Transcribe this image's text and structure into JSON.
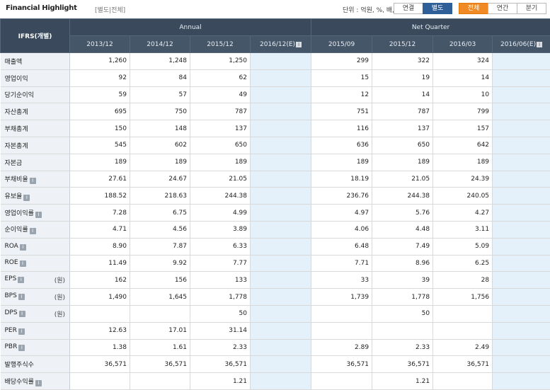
{
  "header": {
    "title": "Financial Highlight",
    "subtitle": "[별도|전체]",
    "unit_label": "단위 : 억원, %, 배, 천주",
    "consolidation_buttons": [
      "연결",
      "별도"
    ],
    "period_buttons": [
      "전체",
      "연간",
      "분기"
    ]
  },
  "table": {
    "corner_label": "IFRS(개별)",
    "group_annual": "Annual",
    "group_quarter": "Net Quarter",
    "columns": [
      "2013/12",
      "2014/12",
      "2015/12",
      "2016/12(E)",
      "2015/09",
      "2015/12",
      "2016/03",
      "2016/06(E)"
    ],
    "rows": [
      {
        "label": "매출액",
        "info": "",
        "unit": "",
        "values": [
          "1,260",
          "1,248",
          "1,250",
          "",
          "299",
          "322",
          "324",
          ""
        ]
      },
      {
        "label": "영업이익",
        "info": "",
        "unit": "",
        "values": [
          "92",
          "84",
          "62",
          "",
          "15",
          "19",
          "14",
          ""
        ]
      },
      {
        "label": "당기순이익",
        "info": "",
        "unit": "",
        "values": [
          "59",
          "57",
          "49",
          "",
          "12",
          "14",
          "10",
          ""
        ]
      },
      {
        "label": "자산총계",
        "info": "",
        "unit": "",
        "values": [
          "695",
          "750",
          "787",
          "",
          "751",
          "787",
          "799",
          ""
        ]
      },
      {
        "label": "부채총계",
        "info": "",
        "unit": "",
        "values": [
          "150",
          "148",
          "137",
          "",
          "116",
          "137",
          "157",
          ""
        ]
      },
      {
        "label": "자본총계",
        "info": "",
        "unit": "",
        "values": [
          "545",
          "602",
          "650",
          "",
          "636",
          "650",
          "642",
          ""
        ]
      },
      {
        "label": "자본금",
        "info": "",
        "unit": "",
        "values": [
          "189",
          "189",
          "189",
          "",
          "189",
          "189",
          "189",
          ""
        ]
      },
      {
        "label": "부채비율",
        "info": "i",
        "unit": "",
        "values": [
          "27.61",
          "24.67",
          "21.05",
          "",
          "18.19",
          "21.05",
          "24.39",
          ""
        ]
      },
      {
        "label": "유보율",
        "info": "i",
        "unit": "",
        "values": [
          "188.52",
          "218.63",
          "244.38",
          "",
          "236.76",
          "244.38",
          "240.05",
          ""
        ]
      },
      {
        "label": "영업이익률",
        "info": "i",
        "unit": "",
        "values": [
          "7.28",
          "6.75",
          "4.99",
          "",
          "4.97",
          "5.76",
          "4.27",
          ""
        ]
      },
      {
        "label": "순이익률",
        "info": "i",
        "unit": "",
        "values": [
          "4.71",
          "4.56",
          "3.89",
          "",
          "4.06",
          "4.48",
          "3.11",
          ""
        ]
      },
      {
        "label": "ROA",
        "info": "i",
        "unit": "",
        "values": [
          "8.90",
          "7.87",
          "6.33",
          "",
          "6.48",
          "7.49",
          "5.09",
          ""
        ]
      },
      {
        "label": "ROE",
        "info": "i",
        "unit": "",
        "values": [
          "11.49",
          "9.92",
          "7.77",
          "",
          "7.71",
          "8.96",
          "6.25",
          ""
        ]
      },
      {
        "label": "EPS",
        "info": "i",
        "unit": "(원)",
        "values": [
          "162",
          "156",
          "133",
          "",
          "33",
          "39",
          "28",
          ""
        ]
      },
      {
        "label": "BPS",
        "info": "i",
        "unit": "(원)",
        "values": [
          "1,490",
          "1,645",
          "1,778",
          "",
          "1,739",
          "1,778",
          "1,756",
          ""
        ]
      },
      {
        "label": "DPS",
        "info": "i",
        "unit": "(원)",
        "values": [
          "",
          "",
          "50",
          "",
          "",
          "50",
          "",
          ""
        ]
      },
      {
        "label": "PER",
        "info": "i",
        "unit": "",
        "values": [
          "12.63",
          "17.01",
          "31.14",
          "",
          "",
          "",
          "",
          ""
        ]
      },
      {
        "label": "PBR",
        "info": "i",
        "unit": "",
        "values": [
          "1.38",
          "1.61",
          "2.33",
          "",
          "2.89",
          "2.33",
          "2.49",
          ""
        ]
      },
      {
        "label": "발행주식수",
        "info": "",
        "unit": "",
        "values": [
          "36,571",
          "36,571",
          "36,571",
          "",
          "36,571",
          "36,571",
          "36,571",
          ""
        ]
      },
      {
        "label": "배당수익률",
        "info": "i",
        "unit": "",
        "values": [
          "",
          "",
          "1.21",
          "",
          "",
          "1.21",
          "",
          ""
        ]
      }
    ]
  }
}
